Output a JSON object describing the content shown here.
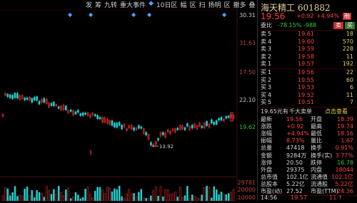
{
  "toolbar": [
    "发",
    "筹",
    "九转",
    "重大事件",
    "◆",
    "10日区",
    "幅",
    "区",
    "扫",
    "扬明",
    "区",
    "撤多",
    "叠"
  ],
  "axis_right": {
    "upper": [
      "30.31",
      "31.63",
      "22.10",
      "17.50",
      "19.62"
    ],
    "lower": [
      "29781",
      "20000",
      "10000"
    ]
  },
  "chart_annotations": {
    "low_label": "13.92"
  },
  "header": {
    "title": "海天精工 601882",
    "price": "19.56",
    "change": "+0.92",
    "pct": "+4.94%",
    "badge": "融"
  },
  "order_book": {
    "ratio_label": "委比",
    "ratio": "-78.15%",
    "diff_label": "-988",
    "sell_label": "卖",
    "buy_label": "买",
    "sells": [
      {
        "level": "5",
        "price": "19.61",
        "vol": "18"
      },
      {
        "level": "4",
        "price": "19.60",
        "vol": "570"
      },
      {
        "level": "3",
        "price": "19.59",
        "vol": "228"
      },
      {
        "level": "2",
        "price": "19.58",
        "vol": "11"
      },
      {
        "level": "1",
        "price": "19.57",
        "vol": "192"
      }
    ],
    "buys": [
      {
        "level": "1",
        "price": "19.56",
        "vol": "22"
      },
      {
        "level": "2",
        "price": "19.55",
        "vol": "60"
      },
      {
        "level": "3",
        "price": "19.53",
        "vol": "6"
      },
      {
        "level": "4",
        "price": "19.52",
        "vol": "11"
      },
      {
        "level": "5",
        "price": "19.51",
        "vol": "7"
      }
    ]
  },
  "big_orders": {
    "price": "19.65元有",
    "label": "千大卖单",
    "link": "点击查看"
  },
  "stats": [
    {
      "k1": "最新",
      "v1": "19.56",
      "k2": "开盘",
      "v2": "18.39"
    },
    {
      "k1": "涨跌",
      "v1": "+0.92",
      "k2": "最高",
      "v2": "19.74"
    },
    {
      "k1": "涨幅",
      "v1": "+4.94%",
      "k2": "最低",
      "v2": "18.16"
    },
    {
      "k1": "振幅",
      "v1": "8.73%",
      "k2": "量比",
      "v2": "1.67"
    },
    {
      "k1": "总量",
      "v1": "47418",
      "k2": "换手",
      "v2": "0.91%"
    },
    {
      "k1": "金额",
      "v1": "9284万",
      "k2": "换手(实)",
      "v2": "3.77%"
    },
    {
      "k1": "涨停",
      "v1": "20.50",
      "k2": "跌停",
      "v2": "16.78"
    },
    {
      "k1": "外盘",
      "v1": "29375",
      "k2": "内盘",
      "v2": "18044"
    },
    {
      "k1": "总市值",
      "v1": "102.1亿",
      "k2": "流通值",
      "v2": "102.1亿"
    },
    {
      "k1": "总股本",
      "v1": "5.22亿",
      "k2": "流通股",
      "v2": "5.22亿"
    },
    {
      "k1": "市盈(动)",
      "v1": "27.52",
      "k2": "市盈(TTM)",
      "v2": "24.36"
    }
  ],
  "tick": {
    "time": "14:56",
    "price": "19.57",
    "vol": "11",
    "dir": "↑"
  },
  "colors": {
    "up": "#ff4040",
    "down": "#33cc33",
    "bg": "#000000",
    "ma": "#e6d04a"
  }
}
